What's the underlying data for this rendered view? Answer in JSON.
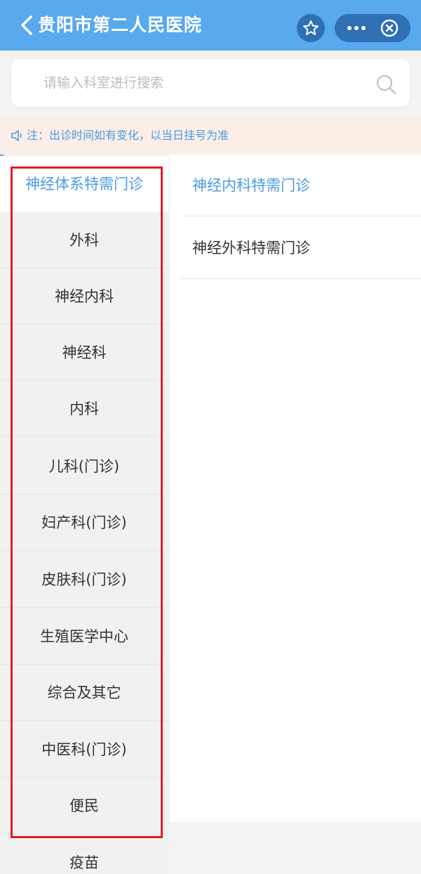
{
  "header": {
    "title": "贵阳市第二人民医院",
    "back_icon": "chevron-left-icon",
    "star_icon": "star-icon",
    "more_icon": "more-dots-icon",
    "close_icon": "close-circle-icon"
  },
  "search": {
    "placeholder": "请输入科室进行搜索",
    "value": "",
    "icon": "search-icon"
  },
  "notice": {
    "icon": "speaker-icon",
    "text": "注：出诊时间如有变化，以当日挂号为准"
  },
  "departments": [
    {
      "label": "神经体系特需门诊",
      "active": true
    },
    {
      "label": "外科"
    },
    {
      "label": "神经内科"
    },
    {
      "label": "神经科"
    },
    {
      "label": "内科"
    },
    {
      "label": "儿科(门诊)"
    },
    {
      "label": "妇产科(门诊)"
    },
    {
      "label": "皮肤科(门诊)"
    },
    {
      "label": "生殖医学中心"
    },
    {
      "label": "综合及其它"
    },
    {
      "label": "中医科(门诊)"
    },
    {
      "label": "便民"
    },
    {
      "label": "疫苗"
    }
  ],
  "sub_departments": [
    {
      "label": "神经内科特需门诊",
      "active": true
    },
    {
      "label": "神经外科特需门诊"
    }
  ],
  "colors": {
    "header_bg": "#58a9ee",
    "accent": "#4b9be3",
    "notice_bg": "#fbeee6",
    "highlight_border": "#e01e28"
  }
}
